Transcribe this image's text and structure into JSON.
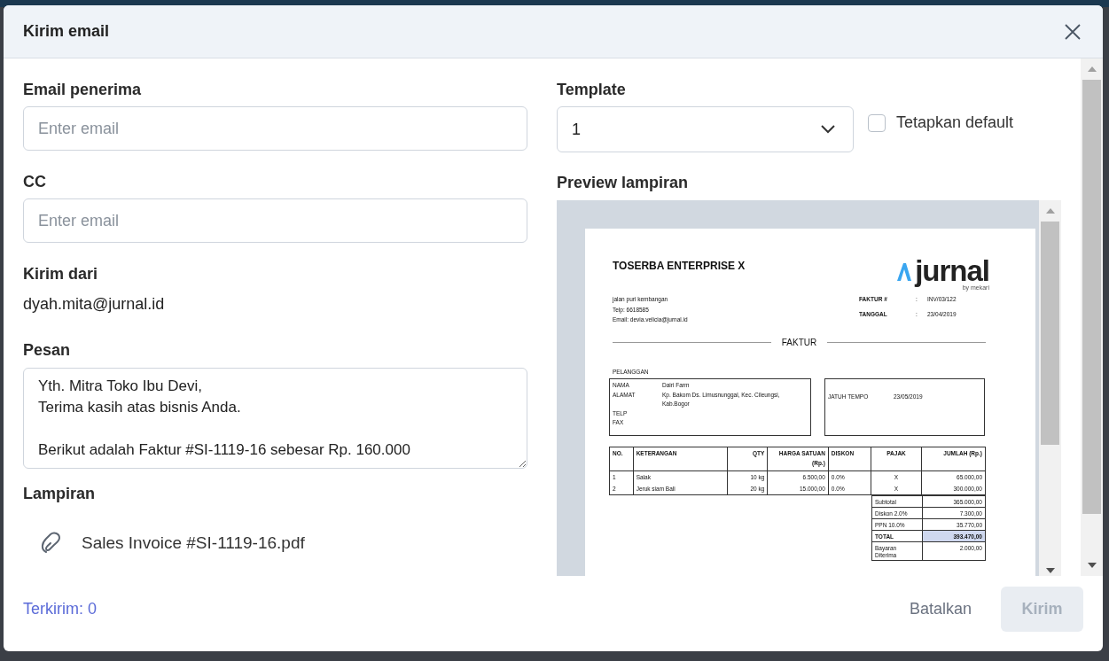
{
  "dialog": {
    "title": "Kirim email"
  },
  "recipient": {
    "label": "Email penerima",
    "placeholder": "Enter email"
  },
  "cc": {
    "label": "CC",
    "placeholder": "Enter email"
  },
  "sender": {
    "label": "Kirim dari",
    "value": "dyah.mita@jurnal.id"
  },
  "message": {
    "label": "Pesan",
    "paragraphs": [
      [
        "Yth. Mitra Toko Ibu Devi,",
        "Terima kasih atas bisnis Anda."
      ],
      [
        "Berikut adalah Faktur #SI-1119-16 sebesar Rp. 160.000"
      ]
    ]
  },
  "attachments": {
    "label": "Lampiran",
    "files": [
      "Sales Invoice #SI-1119-16.pdf"
    ]
  },
  "template": {
    "label": "Template",
    "value": "1"
  },
  "set_default": {
    "label": "Tetapkan default",
    "checked": false
  },
  "preview": {
    "label": "Preview lampiran",
    "document": {
      "company": "TOSERBA ENTERPRISE X",
      "logo_text": "jurnal",
      "logo_sub": "by mekari",
      "address_lines": [
        "jalan puri kembangan",
        "Telp: 6618585",
        "Email: devia.velicia@jurnal.id"
      ],
      "meta": [
        {
          "label": "FAKTUR #",
          "separator": ":",
          "value": "INV/03/122"
        },
        {
          "label": "TANGGAL",
          "separator": ":",
          "value": "23/04/2019"
        }
      ],
      "title": "FAKTUR",
      "customer_heading": "PELANGGAN",
      "customer": [
        {
          "label": "NAMA",
          "value": "Dairi Farm"
        },
        {
          "label": "ALAMAT",
          "value": "Kp. Bakom Ds. Limusnunggal, Kec. Cileungsi, Kab.Bogor"
        },
        {
          "label": "TELP"
        },
        {
          "label": "FAX"
        }
      ],
      "due": {
        "label": "JATUH TEMPO",
        "value": "23/05/2019"
      },
      "columns": [
        "NO.",
        "KETERANGAN",
        "QTY",
        "HARGA SATUAN (Rp.)",
        "DISKON",
        "PAJAK",
        "JUMLAH (Rp.)"
      ],
      "rows": [
        [
          "1",
          "Salak",
          "10 kg",
          "6.500,00",
          "0.0%",
          "X",
          "65.000,00"
        ],
        [
          "2",
          "Jeruk siam Bali",
          "20 kg",
          "15.000,00",
          "0.0%",
          "X",
          "300.000,00"
        ]
      ],
      "totals": [
        {
          "label": "Subtotal",
          "value": "365.000,00",
          "emphasis": false
        },
        {
          "label": "Diskon 2.0%",
          "value": "7.300,00",
          "emphasis": false
        },
        {
          "label": "PPN 10.0%",
          "value": "35.770,00",
          "emphasis": false
        },
        {
          "label": "TOTAL",
          "value": "393.470,00",
          "emphasis": true
        },
        {
          "label": "Bayaran Diterima",
          "value": "2.000,00",
          "emphasis": false
        }
      ]
    }
  },
  "footer": {
    "sent_count": "Terkirim: 0",
    "cancel": "Batalkan",
    "send": {
      "label": "Kirim",
      "disabled": true
    }
  }
}
